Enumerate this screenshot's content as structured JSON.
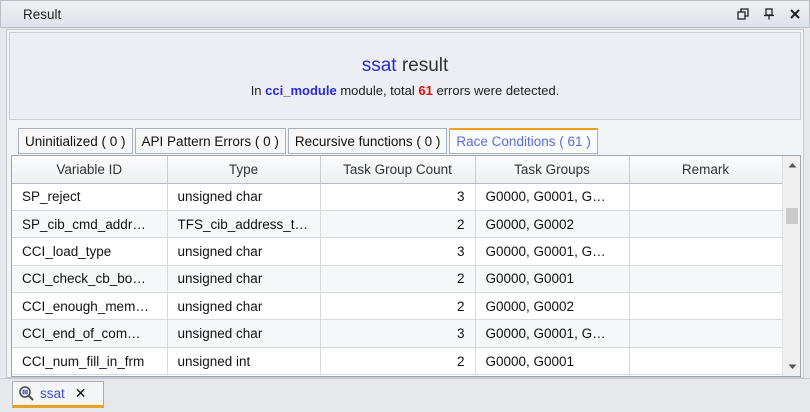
{
  "window": {
    "title": "Result"
  },
  "header": {
    "tool_name": "ssat",
    "title_suffix": "result",
    "sub_prefix": "In",
    "module_name": "cci_module",
    "sub_middle": "module, total",
    "error_count": "61",
    "sub_suffix": "errors were detected."
  },
  "tabs": [
    {
      "label": "Uninitialized ( 0 )",
      "active": false
    },
    {
      "label": "API Pattern Errors ( 0 )",
      "active": false
    },
    {
      "label": "Recursive functions ( 0 )",
      "active": false
    },
    {
      "label": "Race Conditions ( 61 )",
      "active": true
    }
  ],
  "table": {
    "columns": [
      "Variable ID",
      "Type",
      "Task Group Count",
      "Task Groups",
      "Remark"
    ],
    "rows": [
      [
        "SP_reject",
        "unsigned char",
        "3",
        "G0000, G0001, G…",
        ""
      ],
      [
        "SP_cib_cmd_addr…",
        "TFS_cib_address_t…",
        "2",
        "G0000, G0002",
        ""
      ],
      [
        "CCI_load_type",
        "unsigned char",
        "3",
        "G0000, G0001, G…",
        ""
      ],
      [
        "CCI_check_cb_bo…",
        "unsigned char",
        "2",
        "G0000, G0001",
        ""
      ],
      [
        "CCI_enough_mem…",
        "unsigned char",
        "2",
        "G0000, G0002",
        ""
      ],
      [
        "CCI_end_of_com…",
        "unsigned char",
        "3",
        "G0000, G0001, G…",
        ""
      ],
      [
        "CCI_num_fill_in_frm",
        "unsigned int",
        "2",
        "G0000, G0001",
        ""
      ]
    ]
  },
  "bottom_tab": {
    "label": "ssat",
    "icon": "search-icon",
    "close": "✕"
  },
  "colors": {
    "accent_orange": "#f0a020",
    "link_blue": "#2a2ad6",
    "error_red": "#e01010",
    "active_tab_text": "#5a6fd0"
  }
}
